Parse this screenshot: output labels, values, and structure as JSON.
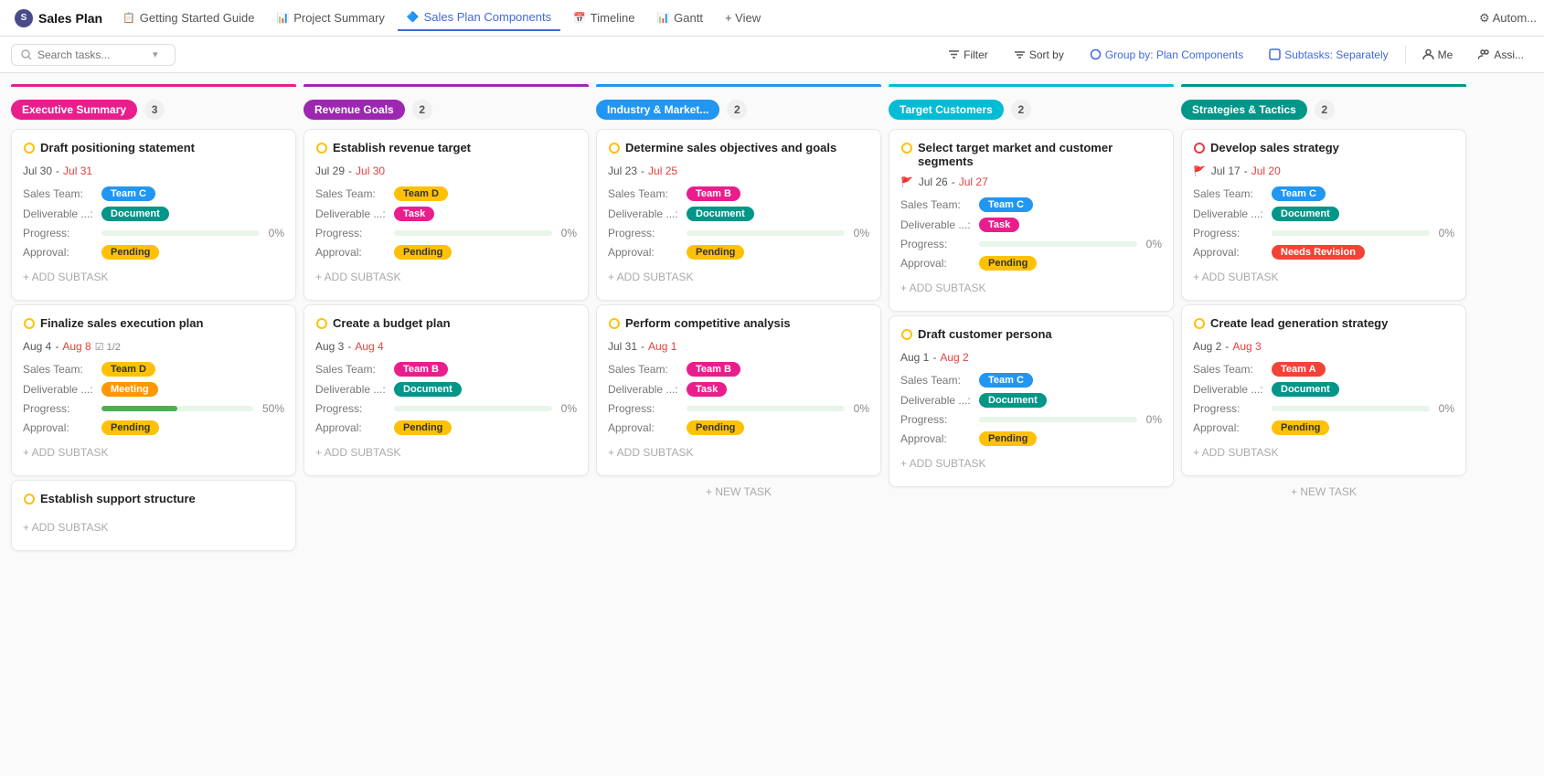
{
  "app": {
    "title": "Sales Plan"
  },
  "tabs": [
    {
      "id": "getting-started",
      "label": "Getting Started Guide",
      "icon": "📋",
      "active": false
    },
    {
      "id": "project-summary",
      "label": "Project Summary",
      "icon": "📊",
      "active": false
    },
    {
      "id": "sales-plan-components",
      "label": "Sales Plan Components",
      "icon": "🔷",
      "active": true
    },
    {
      "id": "timeline",
      "label": "Timeline",
      "icon": "📅",
      "active": false
    },
    {
      "id": "gantt",
      "label": "Gantt",
      "icon": "📊",
      "active": false
    },
    {
      "id": "view",
      "label": "+ View",
      "icon": "",
      "active": false
    }
  ],
  "toolbar": {
    "search_placeholder": "Search tasks...",
    "filter_label": "Filter",
    "sort_label": "Sort by",
    "group_label": "Group by: Plan Components",
    "subtasks_label": "Subtasks: Separately",
    "me_label": "Me",
    "assign_label": "Assi..."
  },
  "columns": [
    {
      "id": "executive-summary",
      "label": "Executive Summary",
      "color": "#e91e8c",
      "stripe": "#e91e8c",
      "count": 3,
      "cards": [
        {
          "title": "Draft positioning statement",
          "icon": "🟡",
          "date_start": "Jul 30",
          "date_end": "Jul 31",
          "date_end_red": true,
          "flag": false,
          "check": false,
          "subtask_fraction": "",
          "fields": [
            {
              "label": "Sales Team:",
              "tag": "Team C",
              "tag_color": "bg-team-c"
            },
            {
              "label": "Deliverable ...:",
              "tag": "Document",
              "tag_color": "bg-document"
            }
          ],
          "progress": 0,
          "approval": "Pending",
          "approval_color": "bg-pending"
        },
        {
          "title": "Finalize sales execution plan",
          "icon": "🟡",
          "date_start": "Aug 4",
          "date_end": "Aug 8",
          "date_end_red": true,
          "flag": false,
          "check": true,
          "subtask_fraction": "1/2",
          "fields": [
            {
              "label": "Sales Team:",
              "tag": "Team D",
              "tag_color": "bg-team-d"
            },
            {
              "label": "Deliverable ...:",
              "tag": "Meeting",
              "tag_color": "bg-meeting"
            }
          ],
          "progress": 50,
          "approval": "Pending",
          "approval_color": "bg-pending"
        },
        {
          "title": "Establish support structure",
          "icon": "🟡",
          "date_start": "",
          "date_end": "",
          "date_end_red": false,
          "flag": false,
          "check": false,
          "subtask_fraction": "",
          "fields": [],
          "progress": 0,
          "approval": "",
          "approval_color": ""
        }
      ]
    },
    {
      "id": "revenue-goals",
      "label": "Revenue Goals",
      "color": "#9c27b0",
      "stripe": "#9c27b0",
      "count": 2,
      "cards": [
        {
          "title": "Establish revenue target",
          "icon": "🟡",
          "date_start": "Jul 29",
          "date_end": "Jul 30",
          "date_end_red": true,
          "flag": false,
          "check": false,
          "subtask_fraction": "",
          "fields": [
            {
              "label": "Sales Team:",
              "tag": "Team D",
              "tag_color": "bg-team-d"
            },
            {
              "label": "Deliverable ...:",
              "tag": "Task",
              "tag_color": "bg-task"
            }
          ],
          "progress": 0,
          "approval": "Pending",
          "approval_color": "bg-pending"
        },
        {
          "title": "Create a budget plan",
          "icon": "🟡",
          "date_start": "Aug 3",
          "date_end": "Aug 4",
          "date_end_red": true,
          "flag": false,
          "check": false,
          "subtask_fraction": "",
          "fields": [
            {
              "label": "Sales Team:",
              "tag": "Team B",
              "tag_color": "bg-team-b"
            },
            {
              "label": "Deliverable ...:",
              "tag": "Document",
              "tag_color": "bg-document"
            }
          ],
          "progress": 0,
          "approval": "Pending",
          "approval_color": "bg-pending"
        }
      ]
    },
    {
      "id": "industry-market",
      "label": "Industry & Market...",
      "color": "#2196f3",
      "stripe": "#2196f3",
      "count": 2,
      "cards": [
        {
          "title": "Determine sales objectives and goals",
          "icon": "🟡",
          "date_start": "Jul 23",
          "date_end": "Jul 25",
          "date_end_red": true,
          "flag": false,
          "check": false,
          "subtask_fraction": "",
          "fields": [
            {
              "label": "Sales Team:",
              "tag": "Team B",
              "tag_color": "bg-team-b"
            },
            {
              "label": "Deliverable ...:",
              "tag": "Document",
              "tag_color": "bg-document"
            }
          ],
          "progress": 0,
          "approval": "Pending",
          "approval_color": "bg-pending"
        },
        {
          "title": "Perform competitive analysis",
          "icon": "🟡",
          "date_start": "Jul 31",
          "date_end": "Aug 1",
          "date_end_red": true,
          "flag": false,
          "check": false,
          "subtask_fraction": "",
          "fields": [
            {
              "label": "Sales Team:",
              "tag": "Team B",
              "tag_color": "bg-team-b"
            },
            {
              "label": "Deliverable ...:",
              "tag": "Task",
              "tag_color": "bg-task"
            }
          ],
          "progress": 0,
          "approval": "Pending",
          "approval_color": "bg-pending"
        }
      ]
    },
    {
      "id": "target-customers",
      "label": "Target Customers",
      "color": "#00bcd4",
      "stripe": "#00bcd4",
      "count": 2,
      "cards": [
        {
          "title": "Select target market and customer segments",
          "icon": "🟡",
          "date_start": "Jul 26",
          "date_end": "Jul 27",
          "date_end_red": true,
          "flag": true,
          "check": false,
          "subtask_fraction": "",
          "fields": [
            {
              "label": "Sales Team:",
              "tag": "Team C",
              "tag_color": "bg-team-c"
            },
            {
              "label": "Deliverable ...:",
              "tag": "Task",
              "tag_color": "bg-task"
            }
          ],
          "progress": 0,
          "approval": "Pending",
          "approval_color": "bg-pending"
        },
        {
          "title": "Draft customer persona",
          "icon": "🟡",
          "date_start": "Aug 1",
          "date_end": "Aug 2",
          "date_end_red": true,
          "flag": false,
          "check": false,
          "subtask_fraction": "",
          "fields": [
            {
              "label": "Sales Team:",
              "tag": "Team C",
              "tag_color": "bg-team-c"
            },
            {
              "label": "Deliverable ...:",
              "tag": "Document",
              "tag_color": "bg-document"
            }
          ],
          "progress": 0,
          "approval": "Pending",
          "approval_color": "bg-pending"
        }
      ]
    },
    {
      "id": "strategies-tactics",
      "label": "Strategies & Tactics",
      "color": "#009688",
      "stripe": "#009688",
      "count": 2,
      "cards": [
        {
          "title": "Develop sales strategy",
          "icon": "🔴",
          "date_start": "Jul 17",
          "date_end": "Jul 20",
          "date_end_red": true,
          "flag": true,
          "check": false,
          "subtask_fraction": "",
          "fields": [
            {
              "label": "Sales Team:",
              "tag": "Team C",
              "tag_color": "bg-team-c"
            },
            {
              "label": "Deliverable ...:",
              "tag": "Document",
              "tag_color": "bg-document"
            }
          ],
          "progress": 0,
          "approval": "Needs Revision",
          "approval_color": "bg-needs-revision"
        },
        {
          "title": "Create lead generation strategy",
          "icon": "🟡",
          "date_start": "Aug 2",
          "date_end": "Aug 3",
          "date_end_red": true,
          "flag": false,
          "check": false,
          "subtask_fraction": "",
          "fields": [
            {
              "label": "Sales Team:",
              "tag": "Team A",
              "tag_color": "bg-team-a"
            },
            {
              "label": "Deliverable ...:",
              "tag": "Document",
              "tag_color": "bg-document"
            }
          ],
          "progress": 0,
          "approval": "Pending",
          "approval_color": "bg-pending"
        }
      ]
    }
  ]
}
